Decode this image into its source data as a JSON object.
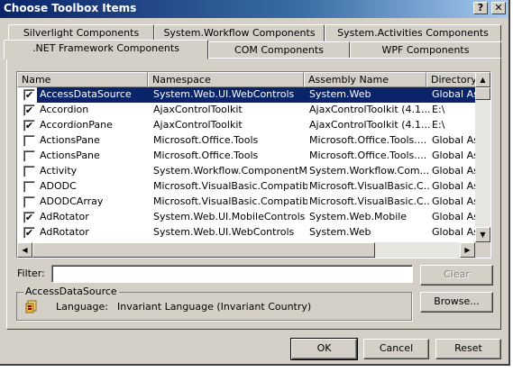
{
  "window": {
    "title": "Choose Toolbox Items",
    "help_button": "?",
    "close_button": "✕"
  },
  "tabs": {
    "back_row": [
      "Silverlight Components",
      "System.Workflow Components",
      "System.Activities Components"
    ],
    "front_row": [
      ".NET Framework Components",
      "COM Components",
      "WPF Components"
    ],
    "active": ".NET Framework Components"
  },
  "list": {
    "columns": [
      "Name",
      "Namespace",
      "Assembly Name",
      "Directory"
    ],
    "rows": [
      {
        "checked": true,
        "name": "AccessDataSource",
        "namespace": "System.Web.UI.WebControls",
        "assembly": "System.Web",
        "directory": "Global Ass",
        "selected": true
      },
      {
        "checked": true,
        "name": "Accordion",
        "namespace": "AjaxControlToolkit",
        "assembly": "AjaxControlToolkit (4.1...",
        "directory": "E:\\"
      },
      {
        "checked": true,
        "name": "AccordionPane",
        "namespace": "AjaxControlToolkit",
        "assembly": "AjaxControlToolkit (4.1...",
        "directory": "E:\\"
      },
      {
        "checked": false,
        "name": "ActionsPane",
        "namespace": "Microsoft.Office.Tools",
        "assembly": "Microsoft.Office.Tools....",
        "directory": "Global Ass"
      },
      {
        "checked": false,
        "name": "ActionsPane",
        "namespace": "Microsoft.Office.Tools",
        "assembly": "Microsoft.Office.Tools....",
        "directory": "Global Ass"
      },
      {
        "checked": false,
        "name": "Activity",
        "namespace": "System.Workflow.ComponentM...",
        "assembly": "System.Workflow.Com...",
        "directory": "Global Ass"
      },
      {
        "checked": false,
        "name": "ADODC",
        "namespace": "Microsoft.VisualBasic.Compatibi...",
        "assembly": "Microsoft.VisualBasic.C...",
        "directory": "Global Ass"
      },
      {
        "checked": false,
        "name": "ADODCArray",
        "namespace": "Microsoft.VisualBasic.Compatibi...",
        "assembly": "Microsoft.VisualBasic.C...",
        "directory": "Global Ass"
      },
      {
        "checked": true,
        "name": "AdRotator",
        "namespace": "System.Web.UI.MobileControls",
        "assembly": "System.Web.Mobile",
        "directory": "Global Ass"
      },
      {
        "checked": true,
        "name": "AdRotator",
        "namespace": "System.Web.UI.WebControls",
        "assembly": "System.Web",
        "directory": "Global Ass"
      }
    ]
  },
  "filter": {
    "label": "Filter:",
    "value": "",
    "clear_button": "Clear"
  },
  "details": {
    "group_title": "AccessDataSource",
    "language_label": "Language:",
    "language_value": "Invariant Language (Invariant Country)",
    "browse_button": "Browse..."
  },
  "footer": {
    "ok": "OK",
    "cancel": "Cancel",
    "reset": "Reset"
  },
  "colors": {
    "title_bar": "#0a246a",
    "selection": "#0a246a",
    "face": "#d4d0c8"
  },
  "icons": {
    "assembly": "assembly-icon",
    "check": "✔",
    "arrow_up": "▲",
    "arrow_down": "▼",
    "arrow_left": "◀",
    "arrow_right": "▶"
  }
}
